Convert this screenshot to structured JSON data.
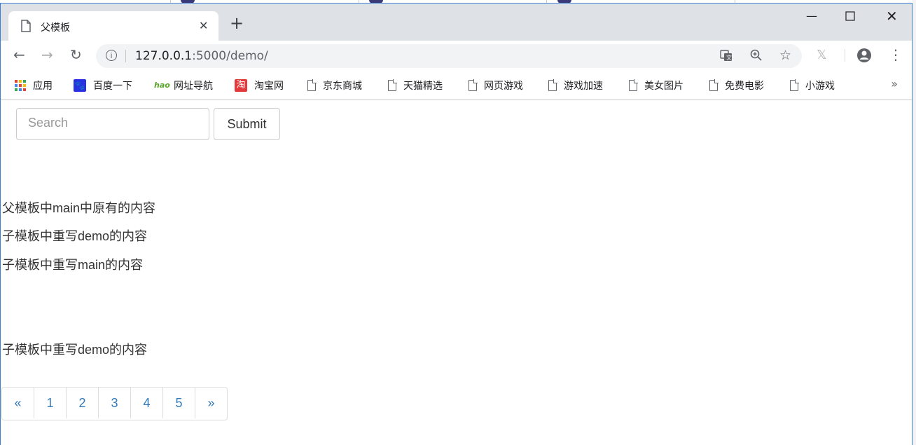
{
  "tab": {
    "title": "父模板"
  },
  "address": {
    "host": "127.0.0.1",
    "port_path": ":5000/demo/"
  },
  "bookmarks": [
    {
      "label": "应用",
      "icon": "apps-icon"
    },
    {
      "label": "百度一下",
      "icon": "baidu-paw-icon"
    },
    {
      "label": "网址导航",
      "icon": "hao-icon"
    },
    {
      "label": "淘宝网",
      "icon": "taobao-icon"
    },
    {
      "label": "京东商城",
      "icon": "page-icon"
    },
    {
      "label": "天猫精选",
      "icon": "page-icon"
    },
    {
      "label": "网页游戏",
      "icon": "page-icon"
    },
    {
      "label": "游戏加速",
      "icon": "page-icon"
    },
    {
      "label": "美女图片",
      "icon": "page-icon"
    },
    {
      "label": "免费电影",
      "icon": "page-icon"
    },
    {
      "label": "小游戏",
      "icon": "page-icon"
    }
  ],
  "search": {
    "placeholder": "Search",
    "submit_label": "Submit"
  },
  "paragraphs": [
    "父模板中main中原有的内容",
    "子模板中重写demo的内容",
    "子模板中重写main的内容",
    "子模板中重写demo的内容"
  ],
  "pagination": [
    "«",
    "1",
    "2",
    "3",
    "4",
    "5",
    "»"
  ],
  "colors": {
    "link": "#337ab7",
    "tabbar": "#dee1e6",
    "window_border": "#3c7fd2"
  }
}
